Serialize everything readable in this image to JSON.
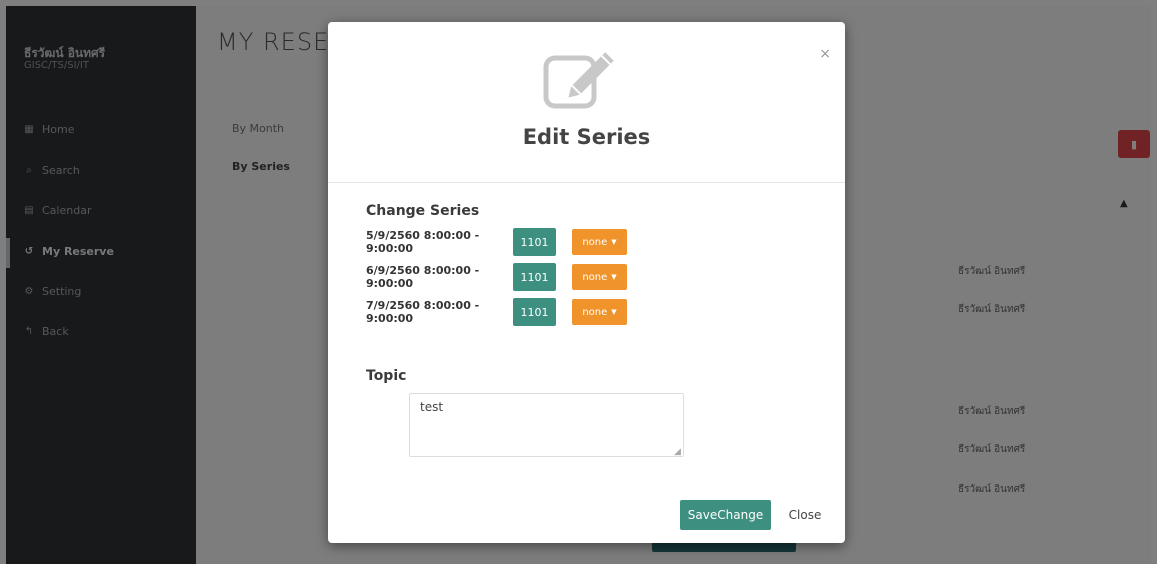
{
  "sidebar": {
    "user_name": "ธีรวัฒน์ อินทศรี",
    "user_dept": "GISC/TS/SI/IT",
    "items": [
      {
        "label": "Home",
        "icon": "grid-icon"
      },
      {
        "label": "Search",
        "icon": "search-icon"
      },
      {
        "label": "Calendar",
        "icon": "calendar-icon"
      },
      {
        "label": "My Reserve",
        "icon": "history-icon"
      },
      {
        "label": "Setting",
        "icon": "gear-icon"
      },
      {
        "label": "Back",
        "icon": "back-arrow-icon"
      }
    ]
  },
  "main": {
    "title": "MY RESEF",
    "tab_month": "By Month",
    "tab_series": "By Series",
    "owner_names": [
      "ธีรวัฒน์ อินทศรี",
      "ธีรวัฒน์ อินทศรี",
      "ธีรวัฒน์ อินทศรี",
      "ธีรวัฒน์ อินทศรี",
      "ธีรวัฒน์ อินทศรี"
    ]
  },
  "modal": {
    "title": "Edit Series",
    "close_symbol": "×",
    "change_series_label": "Change Series",
    "rows": [
      {
        "time": "5/9/2560 8:00:00 - 9:00:00",
        "room": "1101",
        "option": "none"
      },
      {
        "time": "6/9/2560 8:00:00 - 9:00:00",
        "room": "1101",
        "option": "none"
      },
      {
        "time": "7/9/2560 8:00:00 - 9:00:00",
        "room": "1101",
        "option": "none"
      }
    ],
    "topic_label": "Topic",
    "topic_value": "test",
    "save_label": "SaveChange",
    "close_label": "Close"
  },
  "colors": {
    "accent_teal": "#3d8f80",
    "accent_orange": "#f0932b",
    "danger_red": "#e0444a",
    "sidebar_bg": "#2f3336"
  }
}
